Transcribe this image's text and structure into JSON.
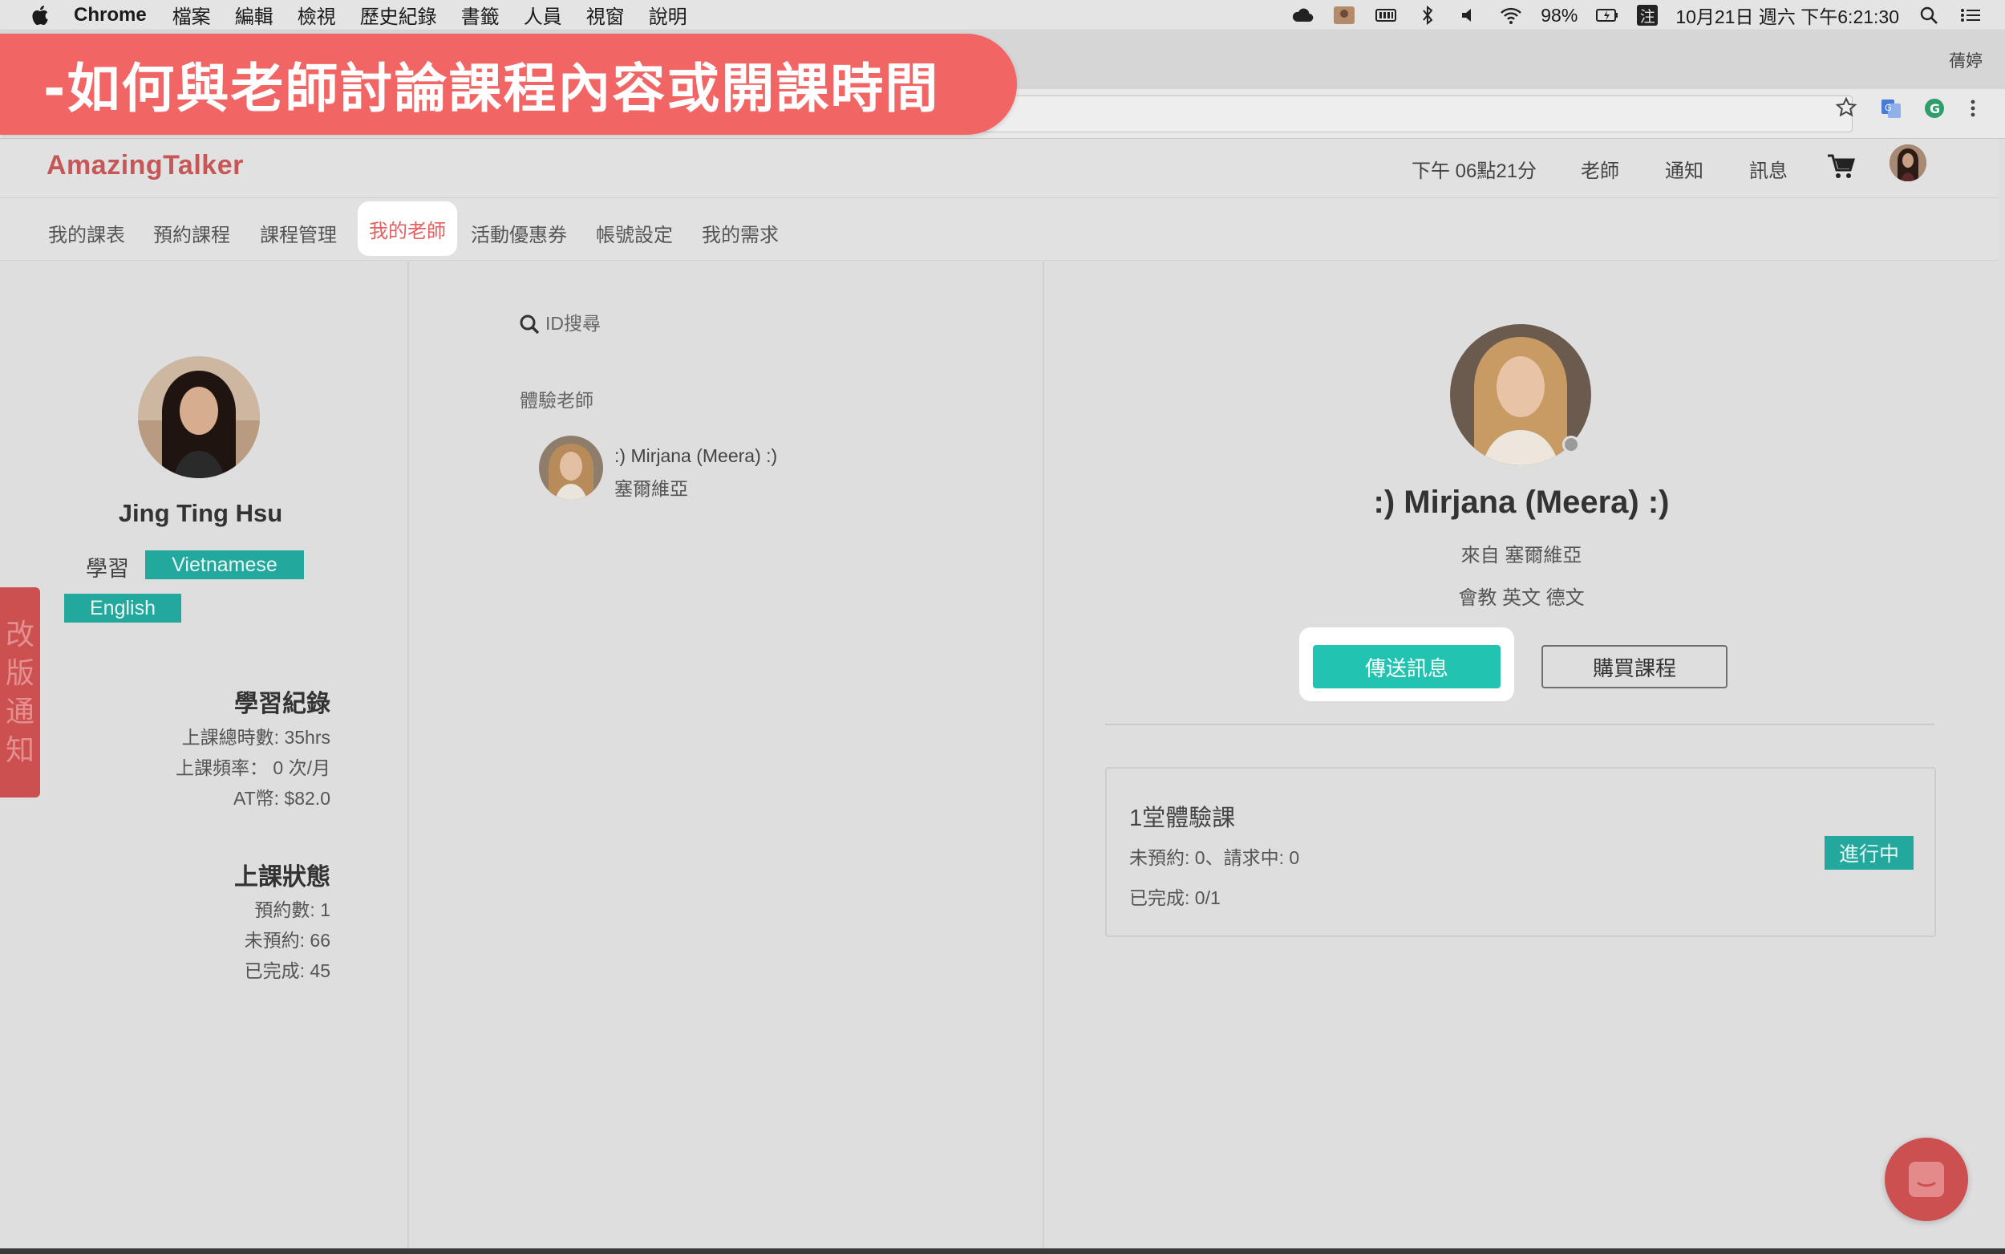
{
  "menubar": {
    "app_name": "Chrome",
    "items": [
      "檔案",
      "編輯",
      "檢視",
      "歷史紀錄",
      "書籤",
      "人員",
      "視窗",
      "說明"
    ],
    "battery": "98%",
    "ime": "注",
    "datetime": "10月21日 週六 下午6:21:30"
  },
  "chrome": {
    "profile_name": "蒨婷"
  },
  "overlay": {
    "title": "-如何與老師討論課程內容或開課時間"
  },
  "site": {
    "logo": "AmazingTalker",
    "header": {
      "time": "下午 06點21分",
      "teacher": "老師",
      "notifications": "通知",
      "messages": "訊息"
    },
    "subnav": [
      "我的課表",
      "預約課程",
      "課程管理",
      "我的老師",
      "活動優惠券",
      "帳號設定",
      "我的需求"
    ],
    "subnav_active": "我的老師"
  },
  "profile": {
    "name": "Jing Ting Hsu",
    "learning_label": "學習",
    "languages": [
      "Vietnamese",
      "English"
    ],
    "side_tab": [
      "改",
      "版",
      "通",
      "知"
    ],
    "record_title": "學習紀錄",
    "record_lines": [
      "上課總時數: 35hrs",
      "上課頻率： 0 次/月",
      "AT幣: $82.0"
    ],
    "status_title": "上課狀態",
    "status_lines": [
      "預約數: 1",
      "未預約: 66",
      "已完成: 45"
    ]
  },
  "teacher_list": {
    "search_placeholder": "ID搜尋",
    "section_label": "體驗老師",
    "items": [
      {
        "name": ":) Mirjana (Meera) :)",
        "country": "塞爾維亞"
      }
    ]
  },
  "teacher_detail": {
    "name": ":) Mirjana (Meera) :)",
    "from": "來自 塞爾維亞",
    "teaches": "會教 英文 德文",
    "send_message": "傳送訊息",
    "buy_course": "購買課程",
    "course": {
      "title": "1堂體驗課",
      "unbooked": "未預約: 0、請求中: 0",
      "completed": "已完成: 0/1",
      "status": "進行中"
    }
  },
  "colors": {
    "brand": "#c85656",
    "banner": "#f26565",
    "teal": "#23c3b1",
    "tag_teal": "#23a89d"
  }
}
